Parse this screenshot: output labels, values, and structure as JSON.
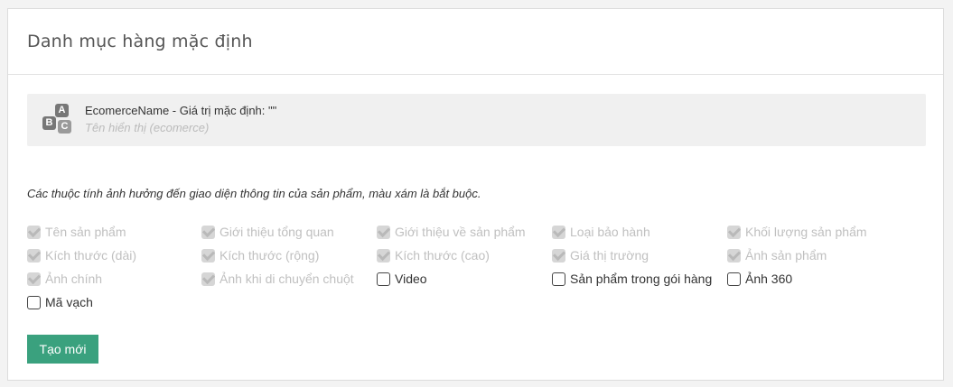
{
  "panel": {
    "title": "Danh mục hàng mặc định"
  },
  "field": {
    "icon": "abc-text-icon",
    "icon_letters": [
      "A",
      "B",
      "C"
    ],
    "label": "EcomerceName - Giá trị mặc định: \"\"",
    "hint": "Tên hiển thị (ecomerce)"
  },
  "note": "Các thuộc tính ảnh hưởng đến giao diện thông tin của sản phẩm, màu xám là bắt buộc.",
  "attributes": [
    {
      "label": "Tên sản phẩm",
      "checked": true
    },
    {
      "label": "Giới thiệu tổng quan",
      "checked": true
    },
    {
      "label": "Giới thiệu về sản phẩm",
      "checked": true
    },
    {
      "label": "Loại bảo hành",
      "checked": true
    },
    {
      "label": "Khối lượng sản phẩm",
      "checked": true
    },
    {
      "label": "Kích thước (dài)",
      "checked": true
    },
    {
      "label": "Kích thước (rộng)",
      "checked": true
    },
    {
      "label": "Kích thước (cao)",
      "checked": true
    },
    {
      "label": "Giá thị trường",
      "checked": true
    },
    {
      "label": "Ảnh sản phẩm",
      "checked": true
    },
    {
      "label": "Ảnh chính",
      "checked": true
    },
    {
      "label": "Ảnh khi di chuyển chuột",
      "checked": true
    },
    {
      "label": "Video",
      "checked": false
    },
    {
      "label": "Sản phẩm trong gói hàng",
      "checked": false
    },
    {
      "label": "Ảnh 360",
      "checked": false
    },
    {
      "label": "Mã vạch",
      "checked": false
    }
  ],
  "create_button": "Tạo mới",
  "colors": {
    "primary_button": "#3aa17e",
    "disabled_text": "#c0c0c0"
  }
}
